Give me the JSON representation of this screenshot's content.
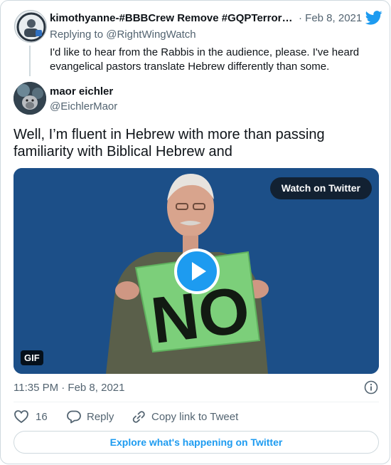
{
  "parent_tweet": {
    "author_name": "kimothyanne-#BBBCrew Remove #GQPTerror…",
    "date": "· Feb 8, 2021",
    "replying_to": "Replying to @RightWingWatch",
    "text": "I'd like to hear from the Rabbis in the audience, please. I've heard evangelical pastors translate Hebrew differently than some."
  },
  "tweet": {
    "author_name": "maor eichler",
    "handle": "@EichlerMaor",
    "text": "Well, I’m fluent in Hebrew with more than passing familiarity with Biblical Hebrew and",
    "timestamp": "11:35 PM · Feb 8, 2021"
  },
  "media": {
    "watch_label": "Watch on Twitter",
    "gif_badge": "GIF",
    "sign_text": "NO"
  },
  "actions": {
    "likes_count": "16",
    "reply_label": "Reply",
    "copy_link_label": "Copy link to Tweet"
  },
  "footer": {
    "explore_label": "Explore what's happening on Twitter"
  },
  "colors": {
    "accent": "#1d9bf0",
    "secondary_text": "#536471",
    "primary_text": "#0f1419",
    "border": "#cfd9de"
  },
  "icons": {
    "brand": "twitter-bird-icon",
    "info": "info-icon",
    "like": "heart-icon",
    "reply": "reply-bubble-icon",
    "copy_link": "link-icon",
    "play": "play-icon"
  }
}
